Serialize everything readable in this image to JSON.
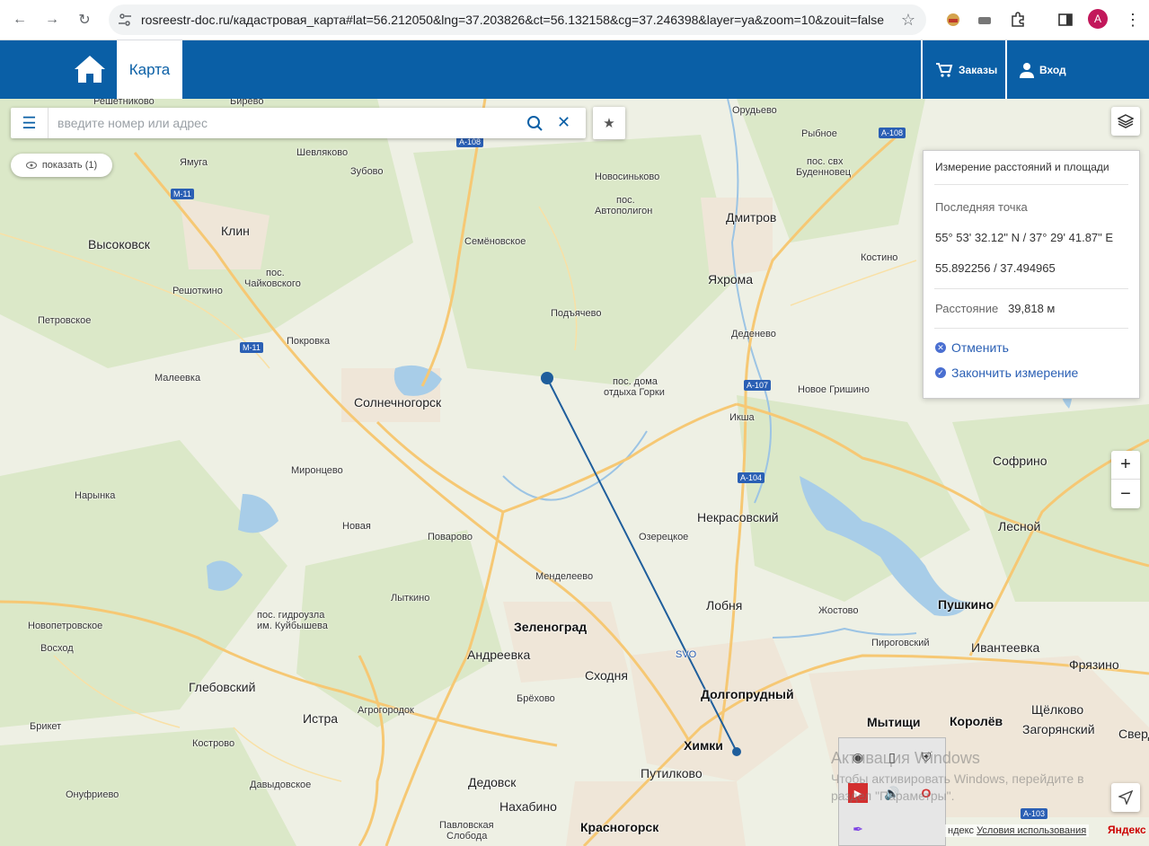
{
  "browser": {
    "url": "rosreestr-doc.ru/кадастровая_карта#lat=56.212050&lng=37.203826&ct=56.132158&cg=37.246398&layer=ya&zoom=10&zouit=false",
    "profile_initial": "A"
  },
  "header": {
    "tab_label": "Карта",
    "orders_label": "Заказы",
    "login_label": "Вход"
  },
  "search": {
    "placeholder": "введите номер или адрес",
    "show_label": "показать (1)"
  },
  "panel": {
    "title": "Измерение расстояний и площади",
    "last_point_label": "Последняя точка",
    "dms": "55° 53' 32.12\" N / 37° 29' 41.87\" E",
    "decimal": "55.892256 / 37.494965",
    "distance_label": "Расстояние",
    "distance_value": "39,818 м",
    "cancel_label": "Отменить",
    "finish_label": "Закончить измерение"
  },
  "attribution": {
    "prefix": "ндекс",
    "terms": "Условия использования",
    "brand": "Яндекс"
  },
  "watermark": {
    "line1": "Активация Windows",
    "line2": "Чтобы активировать Windows, перейдите в",
    "line3": "раздел \"Параметры\"."
  },
  "map": {
    "places": {
      "p1": "Решетниково",
      "p2": "Бирево",
      "p3": "Орудьево",
      "p4": "Рыбное",
      "p5": "Шевляково",
      "p6": "Ямуга",
      "p7": "Зубово",
      "p8": "Новосиньково",
      "p9": "пос. свх",
      "p10": "Буденновец",
      "p11": "пос.",
      "p12": "Автополигон",
      "p13": "Высоковск",
      "p14": "Клин",
      "p15": "Семёновское",
      "p16": "Дмитров",
      "p17": "Костино",
      "p18": "пос.",
      "p19": "Чайковского",
      "p20": "Решоткино",
      "p21": "Яхрома",
      "p22": "Петровское",
      "p23": "Подъячево",
      "p24": "Деденево",
      "p25": "Покровка",
      "p26": "Малеевка",
      "p27": "пос. дома",
      "p28": "отдыха Горки",
      "p29": "Новое Гришино",
      "p30": "Солнечногорск",
      "p31": "Икша",
      "p32": "Софрино",
      "p33": "Миронцево",
      "p34": "Нарынка",
      "p35": "Некрасовский",
      "p36": "Новая",
      "p37": "Поварово",
      "p38": "Озерецкое",
      "p39": "Лесной",
      "p40": "Менделеево",
      "p41": "Лыткино",
      "p42": "Лобня",
      "p43": "Жостово",
      "p44": "Пушкино",
      "p45": "пос. гидроузла",
      "p46": "им. Куйбышева",
      "p47": "Зеленоград",
      "p48": "Новопетровское",
      "p49": "Пироговский",
      "p50": "Восход",
      "p51": "Андреевка",
      "p52": "Сходня",
      "p53": "Ивантеевка",
      "p54": "Фрязино",
      "p55": "Глебовский",
      "p56": "Долгопрудный",
      "p57": "Брёхово",
      "p58": "Агрогородок",
      "p59": "Истра",
      "p60": "Мытищи",
      "p61": "Королёв",
      "p62": "Щёлково",
      "p63": "Брикет",
      "p64": "Загорянский",
      "p65": "Химки",
      "p66": "Кострово",
      "p67": "Путилково",
      "p68": "Давыдовское",
      "p69": "Дедовск",
      "p70": "Онуфриево",
      "p71": "Нахабино",
      "p72": "Павловская",
      "p73": "Слобода",
      "p74": "Красногорск",
      "p75": "Сверд"
    },
    "roads": {
      "r1": "А-108",
      "r2": "А-108",
      "r3": "М-11",
      "r4": "М-11",
      "r5": "А-107",
      "r6": "А-104",
      "r7": "А-103",
      "r8": "SVO"
    }
  },
  "colors": {
    "header_blue": "#0a5fa6",
    "link_blue": "#2a5fb4",
    "measure_line": "#1f5e9c"
  }
}
